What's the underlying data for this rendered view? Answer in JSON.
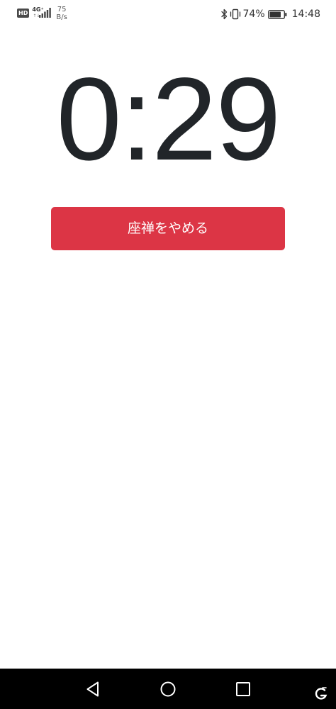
{
  "status_bar": {
    "hd_badge": "HD",
    "network_type": "4G⁺",
    "network_arrows": "↑↓",
    "speed_value": "75",
    "speed_unit": "B/s",
    "battery_percent": "74%",
    "time": "14:48",
    "icons": [
      "signal-icon",
      "bluetooth-icon",
      "vibrate-icon",
      "battery-icon"
    ]
  },
  "timer": {
    "display": "0:29"
  },
  "actions": {
    "stop_label": "座禅をやめる"
  },
  "nav_bar": {
    "icons": [
      "back-icon",
      "home-icon",
      "recent-apps-icon"
    ]
  },
  "colors": {
    "timer_text": "#212529",
    "stop_button": "#dc3545",
    "nav_bar": "#000000",
    "background": "#ffffff"
  }
}
